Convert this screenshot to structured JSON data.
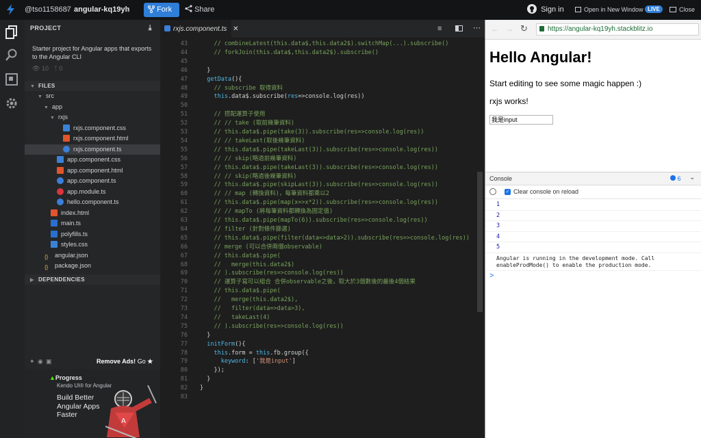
{
  "topbar": {
    "user": "@tso1158687",
    "project": "angular-kq19yh",
    "fork_label": "Fork",
    "share_label": "Share",
    "signin_label": "Sign in",
    "open_new_window_label": "Open in New Window",
    "live_badge": "LIVE",
    "close_label": "Close",
    "accent_color": "#2f7ed8"
  },
  "sidebar": {
    "project_header": "PROJECT",
    "description": "Starter project for Angular apps that exports to the Angular CLI",
    "views": "10",
    "forks": "0",
    "files_header": "FILES",
    "dependencies_header": "DEPENDENCIES",
    "tree": [
      {
        "label": "src",
        "kind": "folder",
        "depth": 1
      },
      {
        "label": "app",
        "kind": "folder",
        "depth": 2
      },
      {
        "label": "rxjs",
        "kind": "folder",
        "depth": 3
      },
      {
        "label": "rxjs.component.css",
        "kind": "css",
        "depth": 4
      },
      {
        "label": "rxjs.component.html",
        "kind": "html",
        "depth": 4
      },
      {
        "label": "rxjs.component.ts",
        "kind": "ts",
        "depth": 4,
        "selected": true
      },
      {
        "label": "app.component.css",
        "kind": "css",
        "depth": 3
      },
      {
        "label": "app.component.html",
        "kind": "html",
        "depth": 3
      },
      {
        "label": "app.component.ts",
        "kind": "ts",
        "depth": 3
      },
      {
        "label": "app.module.ts",
        "kind": "ng",
        "depth": 3
      },
      {
        "label": "hello.component.ts",
        "kind": "ts",
        "depth": 3
      },
      {
        "label": "index.html",
        "kind": "html",
        "depth": 2
      },
      {
        "label": "main.ts",
        "kind": "ts-file",
        "depth": 2
      },
      {
        "label": "polyfills.ts",
        "kind": "ts-file",
        "depth": 2
      },
      {
        "label": "styles.css",
        "kind": "css",
        "depth": 2
      },
      {
        "label": "angular.json",
        "kind": "json",
        "depth": 1
      },
      {
        "label": "package.json",
        "kind": "json",
        "depth": 1
      }
    ],
    "remove_ads_label": "Remove Ads!",
    "go_label": "Go",
    "ad": {
      "brand": "Progress",
      "product": "Kendo UI® for Angular",
      "headline_1": "Build Better",
      "headline_2": "Angular Apps",
      "headline_3": "Faster"
    }
  },
  "editor": {
    "tab_label": "rxjs.component.ts",
    "lines": [
      {
        "n": "43",
        "tokens": [
          [
            "cm",
            "    // combineLatest(this.data$,this.data2$).switchMap(...).subscribe()"
          ]
        ]
      },
      {
        "n": "44",
        "tokens": [
          [
            "cm",
            "    // forkJoin(this.data$,this.data2$).subscribe()"
          ]
        ]
      },
      {
        "n": "45",
        "tokens": [
          [
            "br",
            ""
          ]
        ]
      },
      {
        "n": "46",
        "tokens": [
          [
            "br",
            "  }"
          ]
        ]
      },
      {
        "n": "47",
        "tokens": [
          [
            "kw",
            "  getData"
          ],
          [
            "br",
            "(){"
          ]
        ]
      },
      {
        "n": "48",
        "tokens": [
          [
            "cm",
            "    // subscribe 取得資料"
          ]
        ]
      },
      {
        "n": "49",
        "tokens": [
          [
            "kw",
            "    this"
          ],
          [
            "br",
            ".data$.subscribe("
          ],
          [
            "kw",
            "res"
          ],
          [
            "br",
            "=>console.log(res))"
          ]
        ]
      },
      {
        "n": "50",
        "tokens": [
          [
            "br",
            ""
          ]
        ]
      },
      {
        "n": "51",
        "tokens": [
          [
            "cm",
            "    // 搭配運算子使用"
          ]
        ]
      },
      {
        "n": "52",
        "tokens": [
          [
            "cm",
            "    // // take (取前幾筆資料)"
          ]
        ]
      },
      {
        "n": "53",
        "tokens": [
          [
            "cm",
            "    // this.data$.pipe(take(3)).subscribe(res=>console.log(res))"
          ]
        ]
      },
      {
        "n": "54",
        "tokens": [
          [
            "cm",
            "    // // takeLast(取後幾筆資料)"
          ]
        ]
      },
      {
        "n": "55",
        "tokens": [
          [
            "cm",
            "    // this.data$.pipe(takeLast(3)).subscribe(res=>console.log(res))"
          ]
        ]
      },
      {
        "n": "56",
        "tokens": [
          [
            "cm",
            "    // // skip(略過前幾筆資料)"
          ]
        ]
      },
      {
        "n": "57",
        "tokens": [
          [
            "cm",
            "    // this.data$.pipe(takeLast(3)).subscribe(res=>console.log(res))"
          ]
        ]
      },
      {
        "n": "58",
        "tokens": [
          [
            "cm",
            "    // // skip(略過後幾筆資料)"
          ]
        ]
      },
      {
        "n": "59",
        "tokens": [
          [
            "cm",
            "    // this.data$.pipe(skipLast(3)).subscribe(res=>console.log(res))"
          ]
        ]
      },
      {
        "n": "60",
        "tokens": [
          [
            "cm",
            "    // // map (轉換資料)，每筆資料都乘以2"
          ]
        ]
      },
      {
        "n": "61",
        "tokens": [
          [
            "cm",
            "    // this.data$.pipe(map(x=>x*2)).subscribe(res=>console.log(res))"
          ]
        ]
      },
      {
        "n": "62",
        "tokens": [
          [
            "cm",
            "    // // mapTo (將每筆資料都轉換為固定值)"
          ]
        ]
      },
      {
        "n": "63",
        "tokens": [
          [
            "cm",
            "    // this.data$.pipe(mapTo(6)).subscribe(res=>console.log(res))"
          ]
        ]
      },
      {
        "n": "64",
        "tokens": [
          [
            "cm",
            "    // filter (針對條件篩選)"
          ]
        ]
      },
      {
        "n": "65",
        "tokens": [
          [
            "cm",
            "    // this.data$.pipe(filter(data=>data>2)).subscribe(res=>console.log(res))"
          ]
        ]
      },
      {
        "n": "66",
        "tokens": [
          [
            "cm",
            "    // merge (可以合併兩個observable)"
          ]
        ]
      },
      {
        "n": "67",
        "tokens": [
          [
            "cm",
            "    // this.data$.pipe("
          ]
        ]
      },
      {
        "n": "68",
        "tokens": [
          [
            "cm",
            "    //   merge(this.data2$)"
          ]
        ]
      },
      {
        "n": "69",
        "tokens": [
          [
            "cm",
            "    // ).subscribe(res=>console.log(res))"
          ]
        ]
      },
      {
        "n": "70",
        "tokens": [
          [
            "cm",
            "    // 運算子寫可以組合 合併observable之後，取大於3個數後的最後4個結果"
          ]
        ]
      },
      {
        "n": "71",
        "tokens": [
          [
            "cm",
            "    // this.data$.pipe("
          ]
        ]
      },
      {
        "n": "72",
        "tokens": [
          [
            "cm",
            "    //   merge(this.data2$),"
          ]
        ]
      },
      {
        "n": "73",
        "tokens": [
          [
            "cm",
            "    //   filter(data=>data>3),"
          ]
        ]
      },
      {
        "n": "74",
        "tokens": [
          [
            "cm",
            "    //   takeLast(4)"
          ]
        ]
      },
      {
        "n": "75",
        "tokens": [
          [
            "cm",
            "    // ).subscribe(res=>console.log(res))"
          ]
        ]
      },
      {
        "n": "76",
        "tokens": [
          [
            "br",
            "  }"
          ]
        ]
      },
      {
        "n": "77",
        "tokens": [
          [
            "kw",
            "  initForm"
          ],
          [
            "br",
            "(){"
          ]
        ]
      },
      {
        "n": "78",
        "tokens": [
          [
            "kw",
            "    this"
          ],
          [
            "br",
            ".form = "
          ],
          [
            "kw",
            "this"
          ],
          [
            "br",
            ".fb.group({"
          ]
        ]
      },
      {
        "n": "79",
        "tokens": [
          [
            "kw",
            "      keyword"
          ],
          [
            "br",
            ": ["
          ],
          [
            "st",
            "'我是input'"
          ],
          [
            "br",
            "]"
          ]
        ]
      },
      {
        "n": "80",
        "tokens": [
          [
            "br",
            "    });"
          ]
        ]
      },
      {
        "n": "81",
        "tokens": [
          [
            "br",
            "  }"
          ]
        ]
      },
      {
        "n": "82",
        "tokens": [
          [
            "br",
            "}"
          ]
        ]
      },
      {
        "n": "83",
        "tokens": [
          [
            "br",
            ""
          ]
        ]
      }
    ]
  },
  "preview": {
    "url": "https://angular-kq19yh.stackblitz.io",
    "heading": "Hello Angular!",
    "line1": "Start editing to see some magic happen :)",
    "line2": "rxjs works!",
    "input_value": "我是input",
    "console_tab": "Console",
    "console_count": "6",
    "clear_label": "Clear console on reload",
    "logs": [
      "1",
      "2",
      "3",
      "4",
      "5"
    ],
    "warn_1": "Angular is running in the development mode. Call",
    "warn_2": "enableProdMode() to enable the production mode.",
    "prompt": ">"
  }
}
